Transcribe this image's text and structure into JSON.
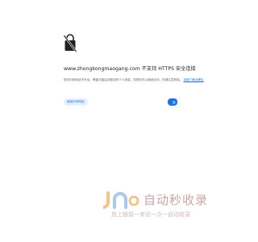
{
  "error": {
    "lock_icon": "lock-broken-icon",
    "title": "www.zhongkongmaogang.com 不支持 HTTPS 安全连接",
    "description": "您访问的网站不安全。黑客可能会窃取您的个人信息。您现在可以继续访问，但请注意风险。",
    "learn_more": "详细了解此警告"
  },
  "buttons": {
    "secondary": "继续访问网站",
    "primary": "返回"
  },
  "watermark": {
    "logo_text": "自动秒收录",
    "tagline": "放上链接一来访一次一自动收录"
  },
  "colors": {
    "accent": "#1a73e8",
    "watermark": "#c9a6a6"
  }
}
